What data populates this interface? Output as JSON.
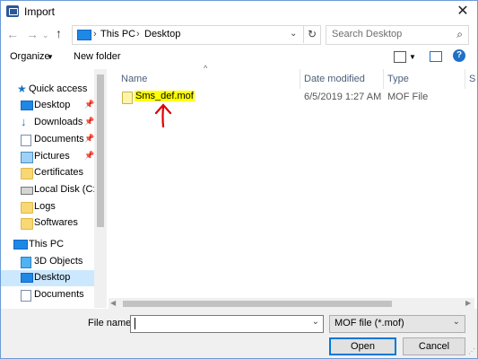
{
  "window": {
    "title": "Import"
  },
  "address": {
    "crumbs": [
      "This PC",
      "Desktop"
    ]
  },
  "search": {
    "placeholder": "Search Desktop"
  },
  "toolbar": {
    "organize": "Organize",
    "new_folder": "New folder"
  },
  "nav": {
    "items": [
      {
        "label": "Quick access",
        "icon": "star-icon",
        "pinned": false
      },
      {
        "label": "Desktop",
        "icon": "desktop-icon",
        "pinned": true
      },
      {
        "label": "Downloads",
        "icon": "download-icon",
        "pinned": true
      },
      {
        "label": "Documents",
        "icon": "document-icon",
        "pinned": true
      },
      {
        "label": "Pictures",
        "icon": "pictures-icon",
        "pinned": true
      },
      {
        "label": "Certificates",
        "icon": "folder-icon",
        "pinned": false
      },
      {
        "label": "Local Disk (C:)",
        "icon": "disk-icon",
        "pinned": false
      },
      {
        "label": "Logs",
        "icon": "folder-icon",
        "pinned": false
      },
      {
        "label": "Softwares",
        "icon": "folder-icon",
        "pinned": false
      },
      {
        "label": "This PC",
        "icon": "pc-icon",
        "pinned": false
      },
      {
        "label": "3D Objects",
        "icon": "3d-objects-icon",
        "pinned": false
      },
      {
        "label": "Desktop",
        "icon": "desktop-icon",
        "pinned": false,
        "selected": true
      },
      {
        "label": "Documents",
        "icon": "document-icon",
        "pinned": false
      }
    ]
  },
  "columns": {
    "name": "Name",
    "date": "Date modified",
    "type": "Type",
    "size": "S"
  },
  "files": [
    {
      "name": "Sms_def.mof",
      "date": "6/5/2019 1:27 AM",
      "type": "MOF File"
    }
  ],
  "footer": {
    "filename_label": "File name:",
    "filename_value": "",
    "filter": "MOF file (*.mof)",
    "open": "Open",
    "cancel": "Cancel"
  },
  "colors": {
    "accent": "#0078d7",
    "selection": "#cce8ff",
    "highlight": "#ffff00",
    "annotation": "#e00000"
  }
}
